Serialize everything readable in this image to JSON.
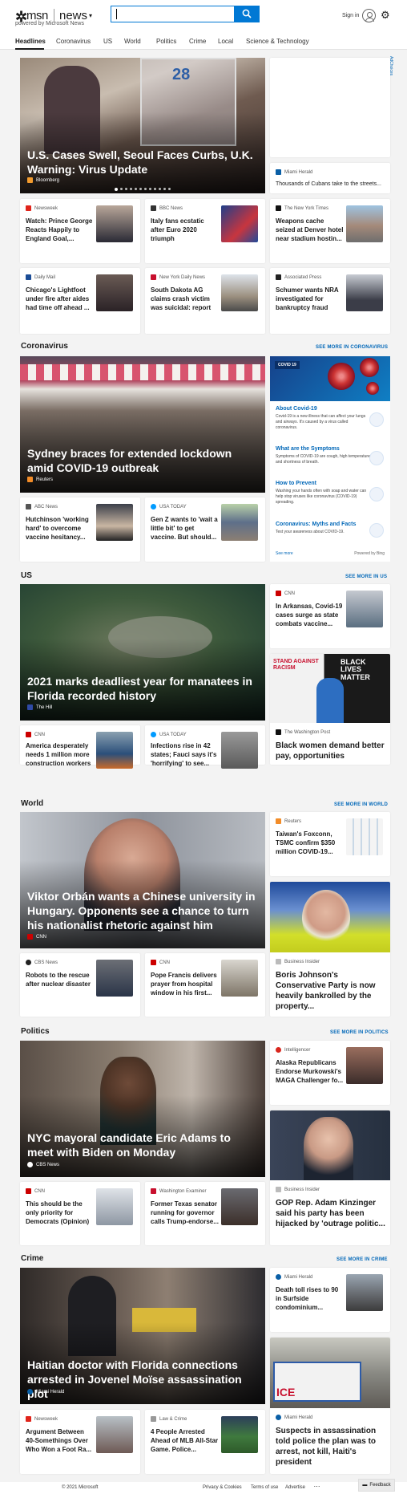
{
  "header": {
    "brand": "msn",
    "section": "news",
    "powered_by": "powered by Microsoft News",
    "search_placeholder": "",
    "sign_in": "Sign in",
    "nav": [
      "Headlines",
      "Coronavirus",
      "US",
      "World",
      "Politics",
      "Crime",
      "Local",
      "Science & Technology"
    ],
    "active_nav": "Headlines"
  },
  "top": {
    "hero": {
      "title": "U.S. Cases Swell, Seoul Faces Curbs, U.K. Warning: Virus Update",
      "source": "Bloomberg",
      "slides": 12,
      "active_slide": 1
    },
    "ad_choices": "AdChoices",
    "side_card": {
      "source": "Miami Herald",
      "title": "Thousands of Cubans take to the streets..."
    },
    "cards": [
      {
        "source": "Newsweek",
        "title": "Watch: Prince George Reacts Happily to England Goal,..."
      },
      {
        "source": "BBC News",
        "title": "Italy fans ecstatic after Euro 2020 triumph"
      },
      {
        "source": "The New York Times",
        "title": "Weapons cache seized at Denver hotel near stadium hostin..."
      },
      {
        "source": "Daily Mail",
        "title": "Chicago's Lightfoot under fire after aides had time off ahead ..."
      },
      {
        "source": "New York Daily News",
        "title": "South Dakota AG claims crash victim was suicidal: report"
      },
      {
        "source": "Associated Press",
        "title": "Schumer wants NRA investigated for bankruptcy fraud"
      }
    ]
  },
  "coronavirus": {
    "heading": "Coronavirus",
    "more": "SEE MORE IN CORONAVIRUS",
    "hero": {
      "title": "Sydney braces for extended lockdown amid COVID-19 outbreak",
      "source": "Reuters"
    },
    "cards": [
      {
        "source": "ABC News",
        "title": "Hutchinson 'working hard' to overcome vaccine hesitancy..."
      },
      {
        "source": "USA TODAY",
        "title": "Gen Z wants to 'wait a little bit' to get vaccine. But should..."
      }
    ],
    "panel": {
      "badge": "COVID 19",
      "items": [
        {
          "title": "About Covid-19",
          "desc": "Covid-19 is a new illness that can affect your lungs and airways. It's caused by a virus called coronavirus."
        },
        {
          "title": "What are the Symptoms",
          "desc": "Symptoms of COVID-19 are cough, high temperature and shortness of breath."
        },
        {
          "title": "How to Prevent",
          "desc": "Washing your hands often with soap and water can help stop viruses like coronavirus (COVID-19) spreading."
        },
        {
          "title": "Coronavirus: Myths and Facts",
          "desc": "Test your awareness about COVID-19."
        }
      ],
      "see_more": "See more",
      "powered": "Powered by Bing"
    }
  },
  "us": {
    "heading": "US",
    "more": "SEE MORE IN US",
    "hero": {
      "title": "2021 marks deadliest year for manatees in Florida recorded history",
      "source": "The Hill"
    },
    "side": {
      "source": "CNN",
      "title": "In Arkansas, Covid-19 cases surge as state combats vaccine..."
    },
    "side_big": {
      "source": "The Washington Post",
      "title": "Black women demand better pay, opportunities",
      "img_text_1": "STAND AGAINST RACISM",
      "img_text_2": "BLACK LIVES MATTER"
    },
    "cards": [
      {
        "source": "CNN",
        "title": "America desperately needs 1 million more construction workers"
      },
      {
        "source": "USA TODAY",
        "title": "Infections rise in 42 states; Fauci says it's 'horrifying' to see..."
      }
    ]
  },
  "world": {
    "heading": "World",
    "more": "SEE MORE IN WORLD",
    "hero": {
      "title": "Viktor Orbán wants a Chinese university in Hungary. Opponents see a chance to turn his nationalist rhetoric against him",
      "source": "CNN"
    },
    "side": {
      "source": "Reuters",
      "title": "Taiwan's Foxconn, TSMC confirm $350 million COVID-19..."
    },
    "side_big": {
      "source": "Business Insider",
      "title": "Boris Johnson's Conservative Party is now heavily bankrolled by the property..."
    },
    "cards": [
      {
        "source": "CBS News",
        "title": "Robots to the rescue after nuclear disaster"
      },
      {
        "source": "CNN",
        "title": "Pope Francis delivers prayer from hospital window in his first..."
      }
    ]
  },
  "politics": {
    "heading": "Politics",
    "more": "SEE MORE IN POLITICS",
    "hero": {
      "title": "NYC mayoral candidate Eric Adams to meet with Biden on Monday",
      "source": "CBS News"
    },
    "side": {
      "source": "Intelligencer",
      "title": "Alaska Republicans Endorse Murkowski's MAGA Challenger fo..."
    },
    "side_big": {
      "source": "Business Insider",
      "title": "GOP Rep. Adam Kinzinger said his party has been hijacked by 'outrage politic..."
    },
    "cards": [
      {
        "source": "CNN",
        "title": "This should be the only priority for Democrats (Opinion)"
      },
      {
        "source": "Washington Examiner",
        "title": "Former Texas senator running for governor calls Trump-endorse..."
      }
    ]
  },
  "crime": {
    "heading": "Crime",
    "more": "SEE MORE IN CRIME",
    "hero": {
      "title": "Haitian doctor with Florida connections arrested in Jovenel Moïse assassination plot",
      "source": "Miami Herald"
    },
    "side": {
      "source": "Miami Herald",
      "title": "Death toll rises to 90 in Surfside condominium..."
    },
    "side_big": {
      "source": "Miami Herald",
      "title": "Suspects in assassination told police the plan was to arrest, not kill, Haiti's president"
    },
    "cards": [
      {
        "source": "Newsweek",
        "title": "Argument Between 40-Somethings Over Who Won a Foot Ra..."
      },
      {
        "source": "Law & Crime",
        "title": "4 People Arrested Ahead of MLB All-Star Game. Police..."
      }
    ]
  },
  "footer": {
    "copyright": "© 2021 Microsoft",
    "links": [
      "Privacy & Cookies",
      "Terms of use",
      "Advertise"
    ],
    "more": "...",
    "feedback": "Feedback"
  }
}
